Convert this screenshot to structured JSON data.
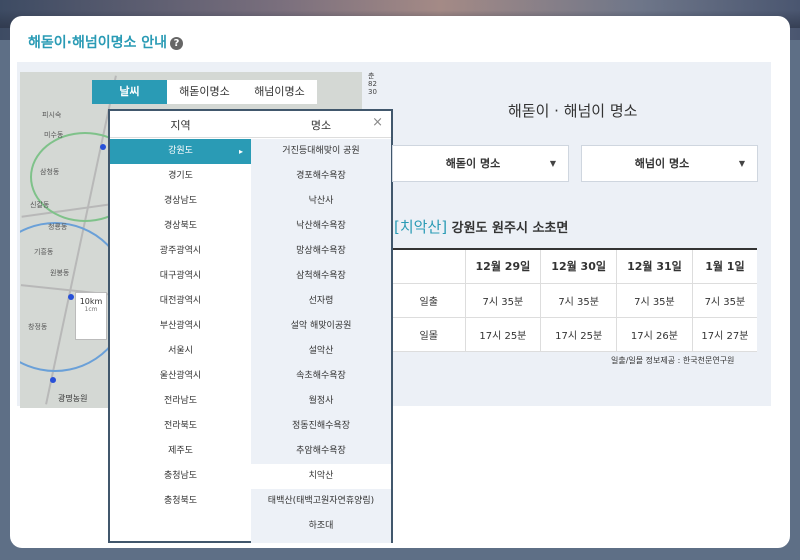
{
  "section": {
    "title": "해돋이·해넘이명소 안내",
    "help_icon": "?"
  },
  "map": {
    "scale_value": "10​km",
    "scale_sub": "1cm",
    "corner_label": "광명농원",
    "right_edge_text": [
      "춘",
      "82",
      "30"
    ],
    "labels": [
      "피시숙",
      "미수동",
      "삼청동",
      "신갈동",
      "청룡동",
      "기흥동",
      "원봉동",
      "창정동"
    ]
  },
  "tabs": [
    {
      "label": "날씨",
      "active": true
    },
    {
      "label": "해돋이명소",
      "active": false
    },
    {
      "label": "해넘이명소",
      "active": false
    }
  ],
  "popup": {
    "col_region": "지역",
    "col_place": "명소",
    "close": "×",
    "regions": [
      "강원도",
      "경기도",
      "경상남도",
      "경상북도",
      "광주광역시",
      "대구광역시",
      "대전광역시",
      "부산광역시",
      "서울시",
      "울산광역시",
      "전라남도",
      "전라북도",
      "제주도",
      "충청남도",
      "충청북도"
    ],
    "active_region": 0,
    "places": [
      "거진등대해맞이 공원",
      "경포해수욕장",
      "낙산사",
      "낙산해수욕장",
      "망상해수욕장",
      "삼척해수욕장",
      "선자령",
      "설악 해맞이공원",
      "설악산",
      "속초해수욕장",
      "월정사",
      "정동진해수욕장",
      "추암해수욕장",
      "치악산",
      "태백산(태백고원자연휴양림)",
      "하조대"
    ],
    "active_place": 13
  },
  "info": {
    "title": "해돋이 · 해넘이 명소",
    "sunrise_select": "해돋이 명소",
    "sunset_select": "해넘이 명소",
    "location_name": "[치악산]",
    "location_address": "강원도 원주시 소초면",
    "table": {
      "headers": [
        "",
        "12월 29일",
        "12월 30일",
        "12월 31일",
        "1월 1일"
      ],
      "rows": [
        {
          "label": "일출",
          "values": [
            "7시 35분",
            "7시 35분",
            "7시 35분",
            "7시 35분"
          ]
        },
        {
          "label": "일몰",
          "values": [
            "17시 25분",
            "17시 25분",
            "17시 26분",
            "17시 27분"
          ]
        }
      ]
    },
    "source": "일출/일몰 정보제공 : 한국천문연구원"
  },
  "colors": {
    "accent": "#2a9bb5",
    "panel": "#ecf0f6",
    "popup_border": "#41576c"
  }
}
